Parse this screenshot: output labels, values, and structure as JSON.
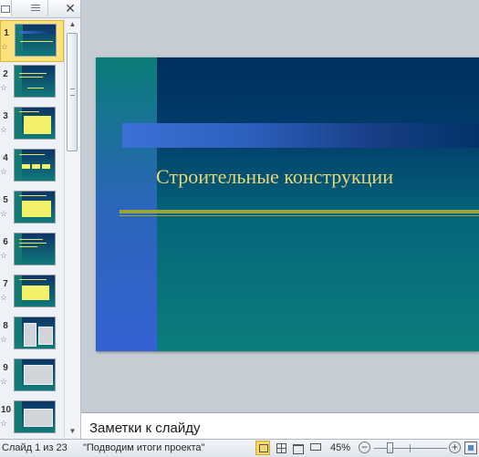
{
  "panel": {
    "close_glyph": "✕",
    "thumbnails": [
      {
        "num": "1",
        "selected": true
      },
      {
        "num": "2"
      },
      {
        "num": "3"
      },
      {
        "num": "4"
      },
      {
        "num": "5"
      },
      {
        "num": "6"
      },
      {
        "num": "7"
      },
      {
        "num": "8"
      },
      {
        "num": "9"
      },
      {
        "num": "10"
      }
    ],
    "transition_glyph": "☆"
  },
  "slide": {
    "title": "Строительные конструкции"
  },
  "notes": {
    "placeholder": "Заметки к слайду"
  },
  "status": {
    "slide_counter": "Слайд 1 из 23",
    "theme": "\"Подводим итоги проекта\"",
    "zoom": "45%",
    "zoom_level_percent": 45
  },
  "colors": {
    "selection": "#fbe27c",
    "slide_title": "#e8d575",
    "slide_top": "#00305e",
    "slide_bottom": "#0b7d7d"
  },
  "icons": [
    "close-icon",
    "slides-tab-icon",
    "outline-tab-icon",
    "transition-star-icon",
    "normal-view-icon",
    "slide-sorter-icon",
    "reading-view-icon",
    "slide-show-icon",
    "zoom-out-icon",
    "zoom-in-icon",
    "fit-to-window-icon"
  ]
}
